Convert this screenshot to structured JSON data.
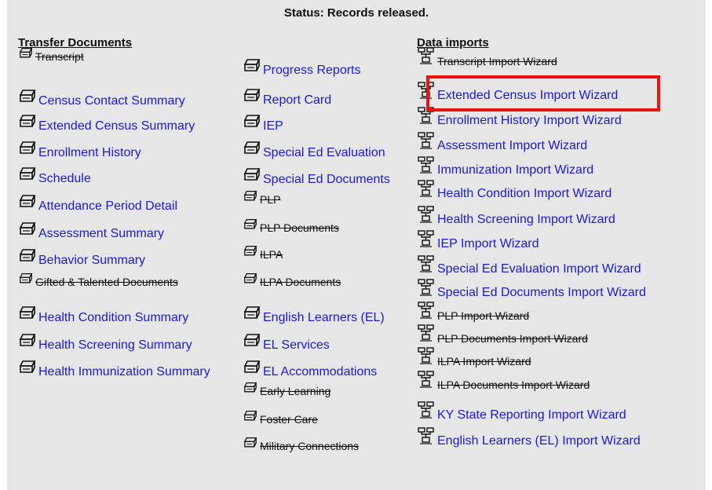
{
  "status": "Status: Records released.",
  "columns": {
    "transfer": {
      "heading": "Transfer Documents",
      "items": [
        {
          "label": "Transcript",
          "enabled": false
        },
        {
          "label": "Census Contact Summary",
          "enabled": true
        },
        {
          "label": "Extended Census Summary",
          "enabled": true
        },
        {
          "label": "Enrollment History",
          "enabled": true
        },
        {
          "label": "Schedule",
          "enabled": true
        },
        {
          "label": "Attendance Period Detail",
          "enabled": true
        },
        {
          "label": "Assessment Summary",
          "enabled": true
        },
        {
          "label": "Behavior Summary",
          "enabled": true
        },
        {
          "label": "Gifted & Talented Documents",
          "enabled": false
        },
        {
          "label": "Health Condition Summary",
          "enabled": true
        },
        {
          "label": "Health Screening Summary",
          "enabled": true
        },
        {
          "label": "Health Immunization Summary",
          "enabled": true
        }
      ]
    },
    "middle": {
      "items": [
        {
          "label": "Progress Reports",
          "enabled": true
        },
        {
          "label": "Report Card",
          "enabled": true
        },
        {
          "label": "IEP",
          "enabled": true
        },
        {
          "label": "Special Ed Evaluation",
          "enabled": true
        },
        {
          "label": "Special Ed Documents",
          "enabled": true
        },
        {
          "label": "PLP",
          "enabled": false
        },
        {
          "label": "PLP Documents",
          "enabled": false
        },
        {
          "label": "ILPA",
          "enabled": false
        },
        {
          "label": "ILPA Documents",
          "enabled": false
        },
        {
          "label": "English Learners (EL)",
          "enabled": true
        },
        {
          "label": "EL Services",
          "enabled": true
        },
        {
          "label": "EL Accommodations",
          "enabled": true
        },
        {
          "label": "Early Learning",
          "enabled": false
        },
        {
          "label": "Foster Care",
          "enabled": false
        },
        {
          "label": "Military Connections",
          "enabled": false
        }
      ]
    },
    "imports": {
      "heading": "Data imports",
      "items": [
        {
          "label": "Transcript Import Wizard",
          "enabled": false
        },
        {
          "label": "Extended Census Import Wizard",
          "enabled": true,
          "highlighted": true
        },
        {
          "label": "Enrollment History Import Wizard",
          "enabled": true
        },
        {
          "label": "Assessment Import Wizard",
          "enabled": true
        },
        {
          "label": "Immunization Import Wizard",
          "enabled": true
        },
        {
          "label": "Health Condition Import Wizard",
          "enabled": true
        },
        {
          "label": "Health Screening Import Wizard",
          "enabled": true
        },
        {
          "label": "IEP Import Wizard",
          "enabled": true
        },
        {
          "label": "Special Ed Evaluation Import Wizard",
          "enabled": true
        },
        {
          "label": "Special Ed Documents Import Wizard",
          "enabled": true
        },
        {
          "label": "PLP Import Wizard",
          "enabled": false
        },
        {
          "label": "PLP Documents Import Wizard",
          "enabled": false
        },
        {
          "label": "ILPA Import Wizard",
          "enabled": false
        },
        {
          "label": "ILPA Documents Import Wizard",
          "enabled": false
        },
        {
          "label": "KY State Reporting Import Wizard",
          "enabled": true
        },
        {
          "label": "English Learners (EL) Import Wizard",
          "enabled": true
        }
      ]
    }
  },
  "colors": {
    "link": "#1a1ad6",
    "disabled": "#111111",
    "highlight": "#e8150e",
    "panel": "#e6e6e6"
  },
  "icons": {
    "document": "printer-icon",
    "import": "wizard-icon"
  }
}
